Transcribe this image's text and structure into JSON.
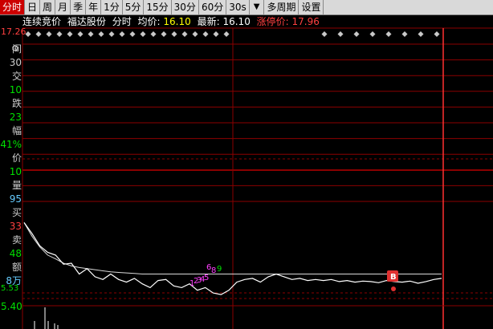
{
  "toolbar": {
    "items": [
      "分时",
      "日",
      "周",
      "月",
      "季",
      "年",
      "1分",
      "5分",
      "15分",
      "30分",
      "60分",
      "30s",
      "多周期",
      "设置"
    ],
    "active_index": 0,
    "dropdown_icon": "caret-down-icon"
  },
  "header": {
    "mode": "连续竞价",
    "stock": "福达股份",
    "chart_type": "分时",
    "avg_label": "均价:",
    "avg_value": "16.10",
    "last_label": "最新:",
    "last_value": "16.10",
    "limit_label": "涨停价:",
    "limit_value": "17.96"
  },
  "price_axis": {
    "top_label": "17.26",
    "mid_label": "5.53",
    "bottom_label": "5.40"
  },
  "side_panel": {
    "labels": [
      "间",
      "30",
      "交",
      "10",
      "跌",
      "23",
      "幅",
      "41%",
      "价",
      "10",
      "量",
      "95",
      "买",
      "33",
      "卖",
      "48",
      "额",
      "8万"
    ]
  },
  "markers": {
    "signal_labels": [
      "1",
      "2",
      "3",
      "4",
      "5",
      "6",
      "8",
      "9"
    ],
    "b_label": "B"
  },
  "colors": {
    "grid": "#8b0000",
    "price_line": "#ffffff",
    "avg_line": "#ffffff",
    "up": "#ff4040",
    "green": "#00e000",
    "yellow": "#ffff00",
    "magenta": "#ff40ff",
    "cyan": "#66ccff",
    "diamond": "#c8c8c8"
  },
  "chart_data": {
    "type": "line",
    "series": [
      {
        "values": [
          17.05,
          16.85,
          16.62,
          16.5,
          16.45,
          16.28,
          16.3,
          16.1,
          16.2,
          16.05,
          16.0,
          16.1,
          16.0,
          15.95,
          16.02,
          15.92,
          15.85,
          15.98,
          16.0,
          15.88,
          15.85,
          15.92,
          15.8,
          15.85,
          15.75,
          15.72,
          15.8,
          15.95,
          16.0,
          16.02,
          15.95,
          16.05,
          16.1,
          16.05,
          16.0,
          16.02,
          15.98,
          16.0,
          15.98,
          16.0,
          15.96,
          15.98,
          15.95,
          15.97,
          15.96,
          15.94,
          15.98,
          15.96,
          15.95,
          15.97,
          15.93,
          15.96,
          16.0,
          16.02
        ]
      },
      {
        "values": [
          17.05,
          16.8,
          16.6,
          16.45,
          16.38,
          16.3,
          16.25,
          16.22,
          16.2,
          16.18,
          16.16,
          16.14,
          16.13,
          16.12,
          16.11,
          16.1,
          16.1,
          16.1,
          16.1,
          16.1,
          16.1,
          16.1,
          16.1,
          16.1,
          16.1,
          16.1,
          16.1,
          16.1,
          16.1,
          16.1,
          16.1,
          16.1,
          16.1,
          16.1,
          16.1,
          16.1,
          16.1,
          16.1,
          16.1,
          16.1,
          16.1,
          16.1,
          16.1,
          16.1,
          16.1,
          16.1,
          16.1,
          16.1,
          16.1,
          16.1,
          16.1,
          16.1,
          16.1,
          16.1
        ]
      }
    ],
    "ylim": [
      15.5,
      17.26
    ]
  }
}
